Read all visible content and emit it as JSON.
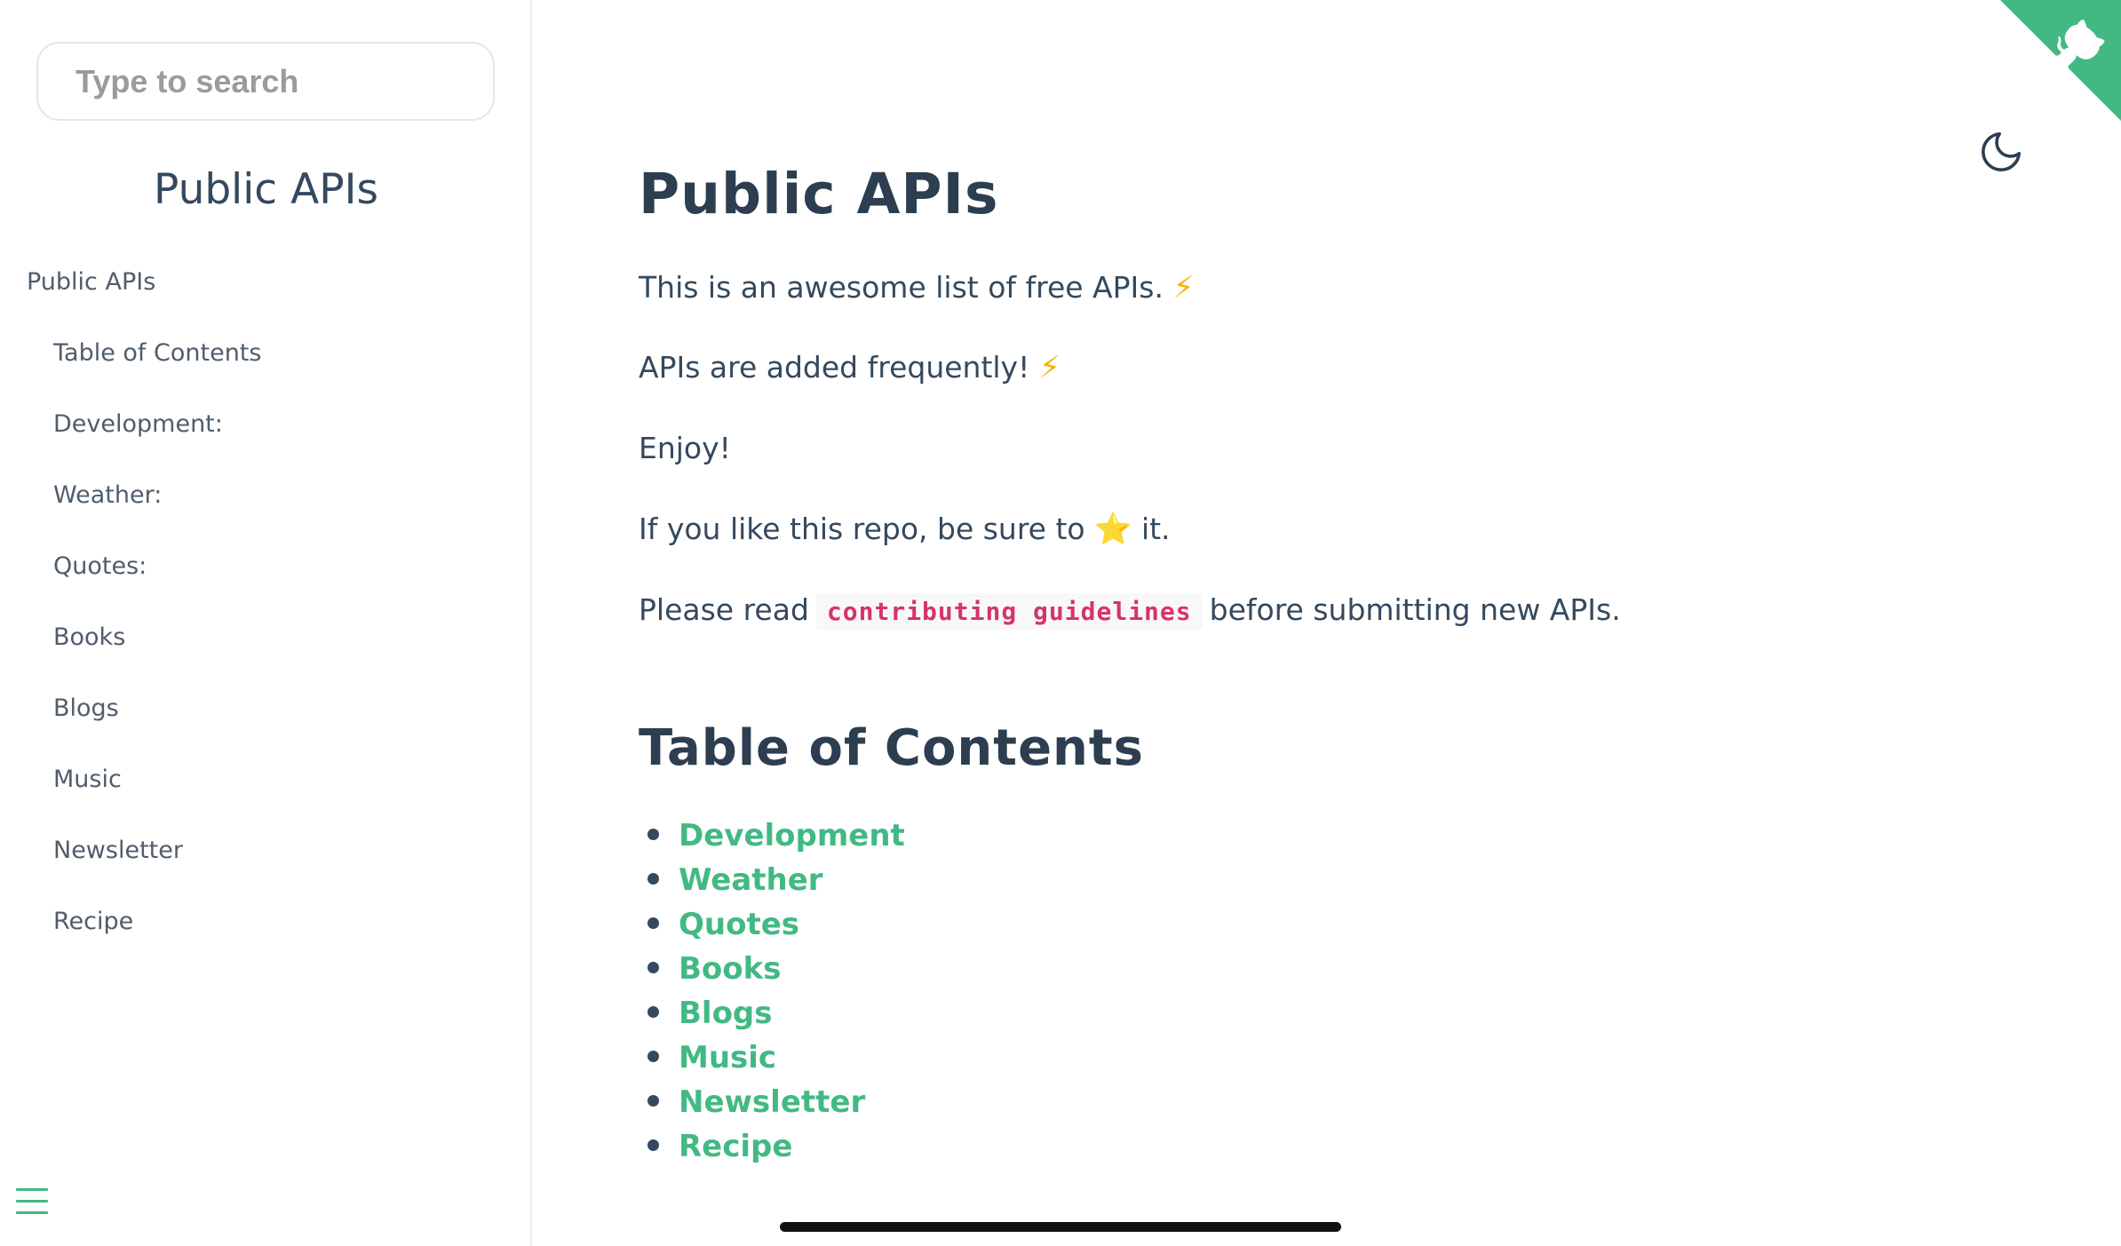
{
  "search": {
    "placeholder": "Type to search"
  },
  "sidebar": {
    "app_name": "Public APIs",
    "items": [
      {
        "label": "Public APIs",
        "level": 1
      },
      {
        "label": "Table of Contents",
        "level": 2
      },
      {
        "label": "Development:",
        "level": 2
      },
      {
        "label": "Weather:",
        "level": 2
      },
      {
        "label": "Quotes:",
        "level": 2
      },
      {
        "label": "Books",
        "level": 2
      },
      {
        "label": "Blogs",
        "level": 2
      },
      {
        "label": "Music",
        "level": 2
      },
      {
        "label": "Newsletter",
        "level": 2
      },
      {
        "label": "Recipe",
        "level": 2
      }
    ]
  },
  "main": {
    "title": "Public APIs",
    "p1_text": "This is an awesome list of free APIs. ",
    "p1_emoji": "⚡",
    "p2_text": "APIs are added frequently! ",
    "p2_emoji": "⚡",
    "p3_text": "Enjoy!",
    "p4_before": "If you like this repo, be sure to ",
    "p4_emoji": "⭐",
    "p4_after": " it.",
    "p5_before": "Please read",
    "p5_code": "contributing guidelines",
    "p5_after": "before submitting new APIs.",
    "toc_title": "Table of Contents",
    "toc": [
      "Development",
      "Weather",
      "Quotes",
      "Books",
      "Blogs",
      "Music",
      "Newsletter",
      "Recipe"
    ]
  },
  "icons": {
    "corner": "github-octocat-icon",
    "theme": "moon-icon",
    "menu": "hamburger-menu-icon"
  },
  "colors": {
    "accent": "#42b983",
    "text": "#34495e",
    "heading": "#2c3e50",
    "code": "#d6336c"
  }
}
